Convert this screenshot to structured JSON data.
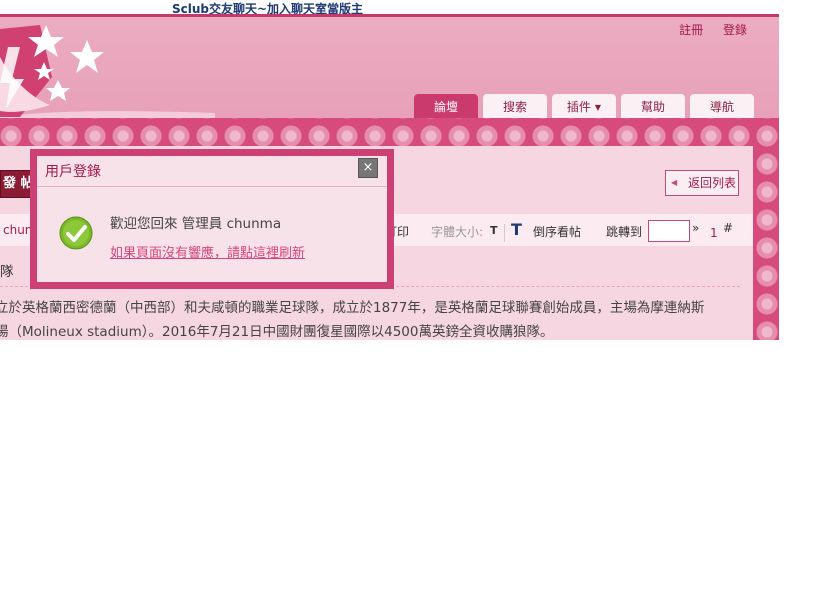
{
  "banner": {
    "text": "Sclub交友聊天~加入聊天室當版主"
  },
  "toplinks": {
    "register": "註冊",
    "login": "登錄"
  },
  "nav": {
    "tabs": [
      {
        "label": "論壇"
      },
      {
        "label": "搜索"
      },
      {
        "label": "插件"
      },
      {
        "label": "幫助"
      },
      {
        "label": "導航"
      }
    ],
    "caret": "▼"
  },
  "post_button": {
    "label": "發 帖"
  },
  "back_to_list": {
    "label": "返回列表",
    "arrow": "◀"
  },
  "toolbar": {
    "author_partial": "chun",
    "print_partial": "打印",
    "font_size_label": "字體大小:",
    "font_size_small": "T",
    "font_size_large": "T",
    "reverse_order": "倒序看帖",
    "jump_to": "跳轉到",
    "next_arrow": "»",
    "page_number": "1",
    "hash": "#"
  },
  "thread": {
    "title_partial": "隊",
    "body_line1": "立於英格蘭西密德蘭（中西部）和夫咸頓的職業足球隊，成立於1877年，是英格蘭足球聯賽創始成員，主場為摩連納斯",
    "body_line2": "場（Molineux stadium）。2016年7月21日中國財團復星國際以4500萬英鎊全資收購狼隊。"
  },
  "modal": {
    "title": "用戶登錄",
    "close": "×",
    "welcome": "歡迎您回來 管理員 chunma",
    "refresh_link": "如果頁面沒有響應，請點這裡刷新"
  }
}
